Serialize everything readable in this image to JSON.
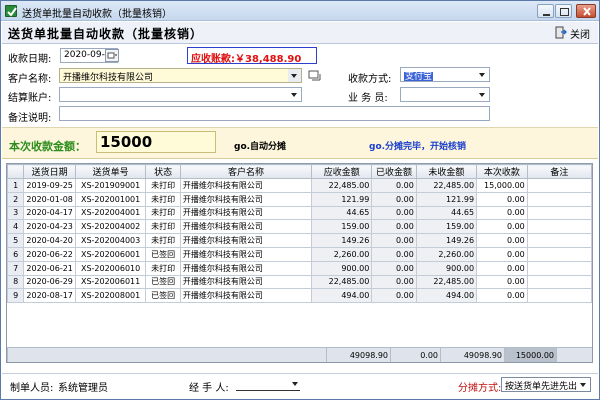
{
  "window": {
    "title": "送货单批量自动收款（批量核销）"
  },
  "header": {
    "title": "送货单批量自动收款（批量核销）",
    "close_label": "关闭"
  },
  "form": {
    "date_label": "收款日期:",
    "date_value": "2020-09-12",
    "amount_due": "应收账款:￥38,488.90",
    "customer_label": "客户名称:",
    "customer_value": "开播维尔科技有限公司",
    "payment_method_label": "收款方式:",
    "payment_method_value": "支付宝",
    "account_label": "结算账户:",
    "account_value": "",
    "salesperson_label": "业 务 员:",
    "salesperson_value": "",
    "remark_label": "备注说明:",
    "remark_value": ""
  },
  "band": {
    "amount_label": "本次收款金额：",
    "amount_value": "15000",
    "auto_allocate": "go.自动分摊",
    "done_message": "go.分摊完毕，开始核销"
  },
  "table": {
    "columns": [
      "",
      "送货日期",
      "送货单号",
      "状态",
      "客户名称",
      "应收金额",
      "已收金额",
      "未收金额",
      "本次收款",
      "备注"
    ],
    "rows": [
      [
        "1",
        "2019-09-25",
        "XS-201909001",
        "未打印",
        "开播维尔科技有限公司",
        "22,485.00",
        "0.00",
        "22,485.00",
        "15,000.00",
        ""
      ],
      [
        "2",
        "2020-01-08",
        "XS-202001001",
        "未打印",
        "开播维尔科技有限公司",
        "121.99",
        "0.00",
        "121.99",
        "0.00",
        ""
      ],
      [
        "3",
        "2020-04-17",
        "XS-202004001",
        "未打印",
        "开播维尔科技有限公司",
        "44.65",
        "0.00",
        "44.65",
        "0.00",
        ""
      ],
      [
        "4",
        "2020-04-23",
        "XS-202004002",
        "未打印",
        "开播维尔科技有限公司",
        "159.00",
        "0.00",
        "159.00",
        "0.00",
        ""
      ],
      [
        "5",
        "2020-04-20",
        "XS-202004003",
        "未打印",
        "开播维尔科技有限公司",
        "149.26",
        "0.00",
        "149.26",
        "0.00",
        ""
      ],
      [
        "6",
        "2020-06-22",
        "XS-202006001",
        "已签回",
        "开播维尔科技有限公司",
        "2,260.00",
        "0.00",
        "2,260.00",
        "0.00",
        ""
      ],
      [
        "7",
        "2020-06-21",
        "XS-202006010",
        "未打印",
        "开播维尔科技有限公司",
        "900.00",
        "0.00",
        "900.00",
        "0.00",
        ""
      ],
      [
        "8",
        "2020-06-29",
        "XS-202006011",
        "已签回",
        "开播维尔科技有限公司",
        "22,485.00",
        "0.00",
        "22,485.00",
        "0.00",
        ""
      ],
      [
        "9",
        "2020-08-17",
        "XS-202008001",
        "已签回",
        "开播维尔科技有限公司",
        "494.00",
        "0.00",
        "494.00",
        "0.00",
        ""
      ]
    ],
    "totals": {
      "receivable": "49098.90",
      "received": "0.00",
      "unreceived": "49098.90",
      "this_payment": "15000.00"
    }
  },
  "footer": {
    "creator_label": "制单人员:",
    "creator_value": "系统管理员",
    "handler_label": "经 手 人:",
    "handler_value": "",
    "method_label": "分摊方式:",
    "method_value": "按送货单先进先出"
  },
  "colors": {
    "accent_green": "#2c8c1c",
    "due_red": "#e01010",
    "blue_text": "#1a3fd0",
    "band_bg": "#fdf6dc"
  }
}
